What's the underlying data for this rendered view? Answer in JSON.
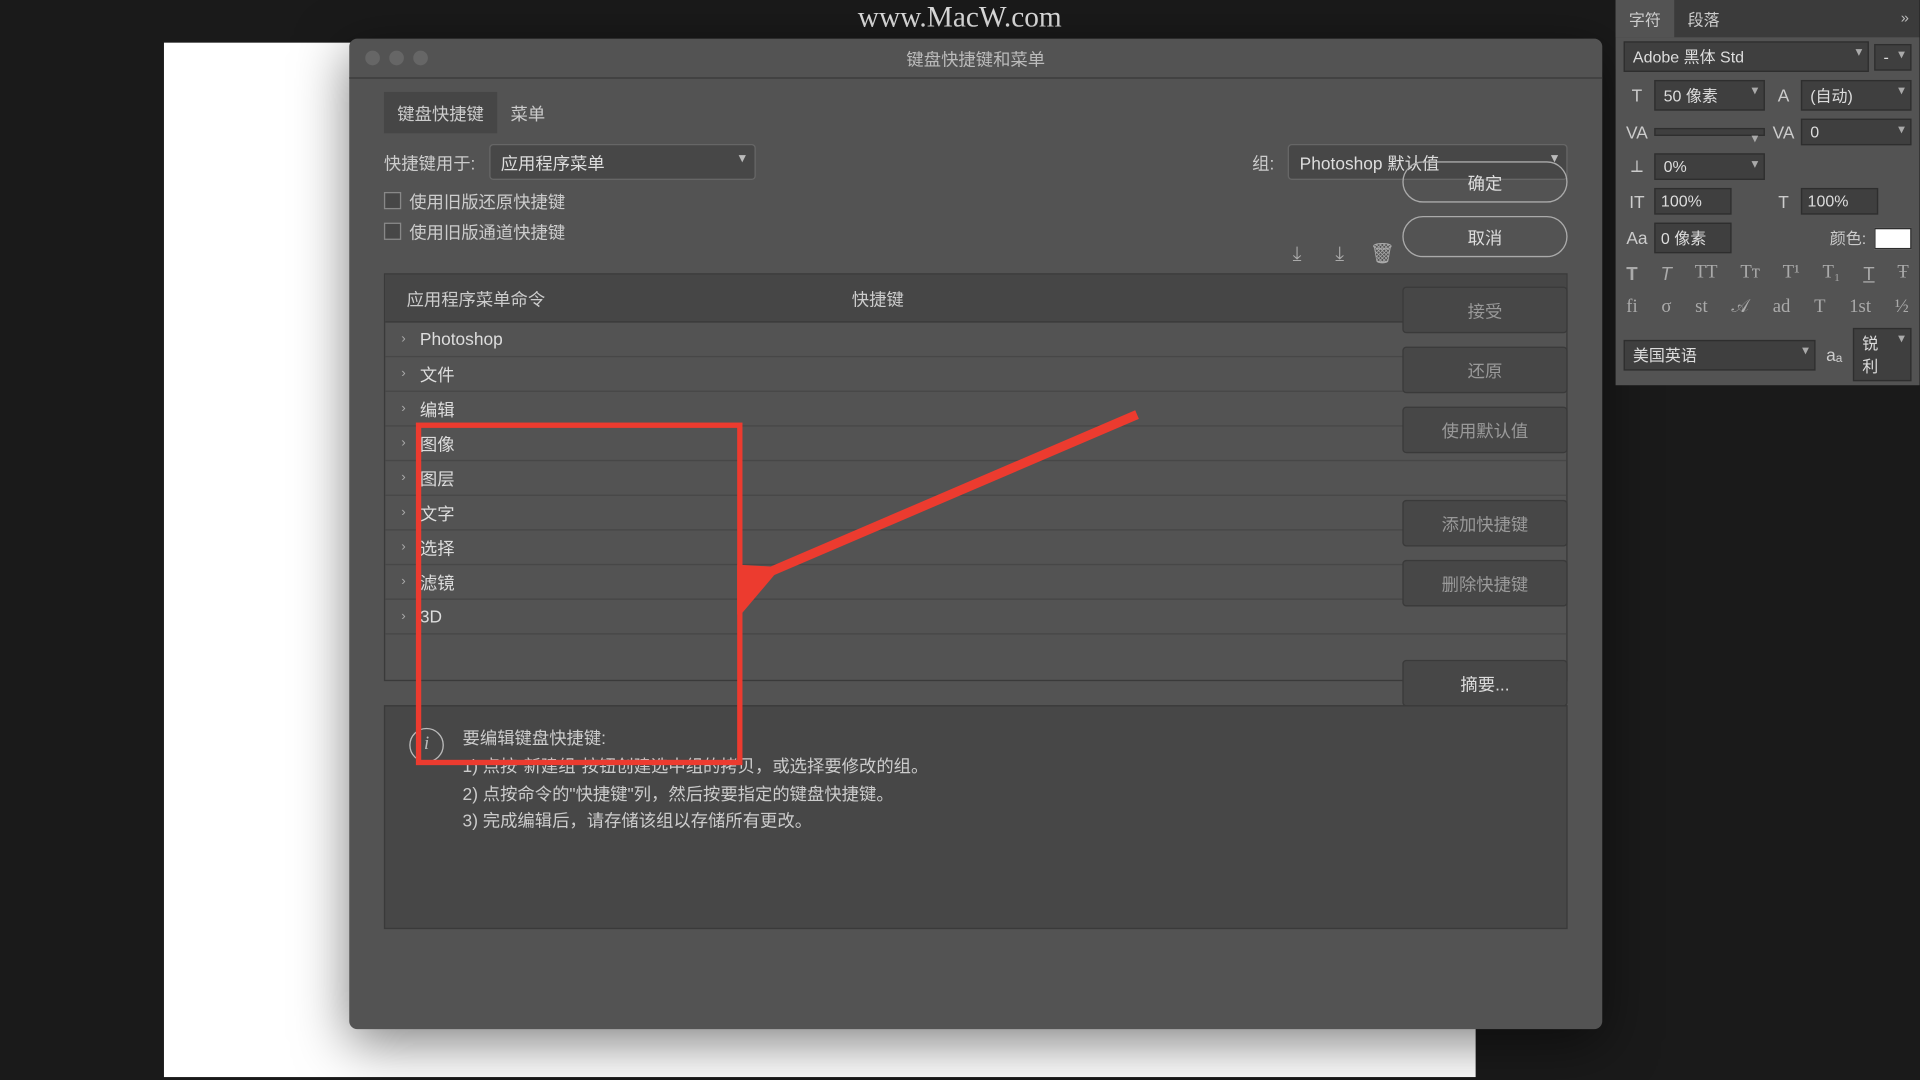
{
  "watermark": "www.MacW.com",
  "dialog": {
    "title": "键盘快捷键和菜单",
    "tabs": [
      "键盘快捷键",
      "菜单"
    ],
    "shortcut_for_label": "快捷键用于:",
    "shortcut_for_value": "应用程序菜单",
    "set_label": "组:",
    "set_value": "Photoshop 默认值",
    "legacy_undo": "使用旧版还原快捷键",
    "legacy_channel": "使用旧版通道快捷键",
    "col_command": "应用程序菜单命令",
    "col_shortcut": "快捷键",
    "tree": [
      "Photoshop",
      "文件",
      "编辑",
      "图像",
      "图层",
      "文字",
      "选择",
      "滤镜",
      "3D"
    ],
    "ok": "确定",
    "cancel": "取消",
    "accept": "接受",
    "undo": "还原",
    "use_default": "使用默认值",
    "add_shortcut": "添加快捷键",
    "delete_shortcut": "删除快捷键",
    "summary": "摘要...",
    "info_title": "要编辑键盘快捷键:",
    "info_1": "1) 点按\"新建组\"按钮创建选中组的拷贝，或选择要修改的组。",
    "info_2": "2) 点按命令的\"快捷键\"列，然后按要指定的键盘快捷键。",
    "info_3": "3) 完成编辑后，请存储该组以存储所有更改。"
  },
  "char": {
    "tab1": "字符",
    "tab2": "段落",
    "font": "Adobe 黑体 Std",
    "style": "-",
    "size": "50 像素",
    "leading": "(自动)",
    "kerning": "",
    "tracking": "0",
    "vscale": "0%",
    "hscale_h": "100%",
    "hscale_v": "100%",
    "baseline": "0 像素",
    "color_label": "颜色:",
    "lang": "美国英语",
    "aa": "锐利"
  }
}
